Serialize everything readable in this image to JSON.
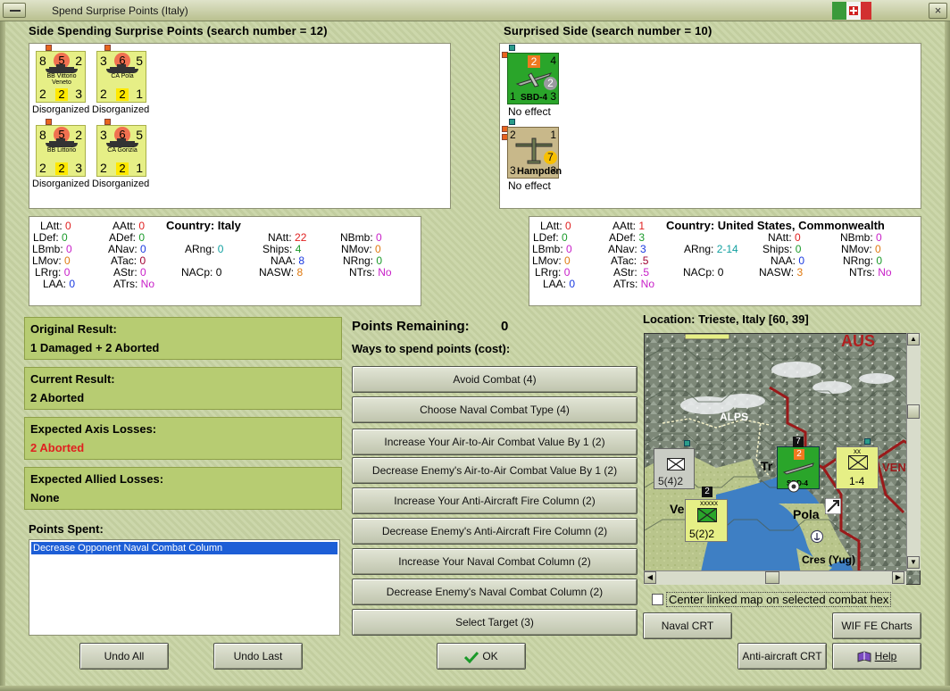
{
  "window": {
    "title": "Spend Surprise Points (Italy)",
    "close": "×"
  },
  "left_side": {
    "title": "Side Spending Surprise Points (search number = 12)",
    "units": [
      {
        "tl": "8",
        "circle": "5",
        "tr": "2",
        "name": "BB Vittorio Veneto",
        "bl": "2",
        "mid": "2",
        "br": "3",
        "status": "Disorganized"
      },
      {
        "tl": "3",
        "circle": "6",
        "tr": "5",
        "name": "CA Pola",
        "bl": "2",
        "mid": "2",
        "br": "1",
        "status": "Disorganized"
      },
      {
        "tl": "8",
        "circle": "5",
        "tr": "2",
        "name": "BB Littorio",
        "bl": "2",
        "mid": "2",
        "br": "3",
        "status": "Disorganized"
      },
      {
        "tl": "3",
        "circle": "6",
        "tr": "5",
        "name": "CA Gorizia",
        "bl": "2",
        "mid": "2",
        "br": "1",
        "status": "Disorganized"
      }
    ]
  },
  "right_side": {
    "title": "Surprised Side (search number = 10)",
    "units": [
      {
        "name": "SBD-4",
        "tl": "2",
        "tr": "4",
        "badge": "2",
        "bl": "1",
        "br": "3",
        "status": "No effect"
      },
      {
        "name": "Hampden",
        "tl": "2",
        "tr": "1",
        "badge": "7",
        "bl": "3",
        "br": "3",
        "status": "No effect"
      }
    ]
  },
  "left_stats": {
    "country_label": "Country:",
    "country": "Italy",
    "LAtt": "0",
    "LDef": "0",
    "LBmb": "0",
    "LMov": "0",
    "LRrg": "0",
    "LAA": "0",
    "AAtt": "0",
    "ADef": "0",
    "ANav": "0",
    "ATac": "0",
    "AStr": "0",
    "ATrs": "No",
    "ARng": "0",
    "NACp": "0",
    "NAtt": "22",
    "Ships": "4",
    "NAA": "8",
    "NASW": "8",
    "NBmb": "0",
    "NMov": "0",
    "NRng": "0",
    "NTrs": "No"
  },
  "right_stats": {
    "country_label": "Country:",
    "country": "United States, Commonwealth",
    "LAtt": "0",
    "LDef": "0",
    "LBmb": "0",
    "LMov": "0",
    "LRrg": "0",
    "LAA": "0",
    "AAtt": "1",
    "ADef": "3",
    "ANav": "3",
    "ATac": ".5",
    "AStr": ".5",
    "ATrs": "No",
    "ARng": "2-14",
    "NACp": "0",
    "NAtt": "0",
    "Ships": "0",
    "NAA": "0",
    "NASW": "3",
    "NBmb": "0",
    "NMov": "0",
    "NRng": "0",
    "NTrs": "No"
  },
  "results": {
    "original_label": "Original Result:",
    "original": "1 Damaged + 2 Aborted",
    "current_label": "Current Result:",
    "current": "2 Aborted",
    "axis_label": "Expected Axis Losses:",
    "axis": "2 Aborted",
    "allied_label": "Expected Allied Losses:",
    "allied": "None",
    "spent_label": "Points Spent:",
    "spent_items": [
      "Decrease Opponent Naval Combat Column"
    ]
  },
  "points": {
    "remaining_label": "Points Remaining:",
    "remaining": "0",
    "ways_label": "Ways to spend points (cost):",
    "options": [
      "Avoid Combat (4)",
      "Choose Naval Combat Type (4)",
      "Increase Your Air-to-Air Combat Value By 1 (2)",
      "Decrease Enemy's Air-to-Air Combat Value By 1 (2)",
      "Increase Your Anti-Aircraft Fire Column (2)",
      "Decrease Enemy's Anti-Aircraft Fire Column (2)",
      "Increase Your Naval Combat Column (2)",
      "Decrease Enemy's Naval Combat Column (2)",
      "Select Target (3)"
    ]
  },
  "map": {
    "location": "Location: Trieste, Italy [60, 39]",
    "labels": {
      "alps": "ALPS",
      "aus": "AUS",
      "pola": "Pola",
      "cres": "Cres (Yug)",
      "ve": "Ve",
      "tr": "Tr",
      "ven": "VEN"
    },
    "counters": {
      "a": "5(4)2",
      "b": "5(2)2",
      "b_top": "xxxxx",
      "c": "1-4",
      "c_top": "xx",
      "d_name": "SBD-4",
      "d_num": "7",
      "d_top": "2",
      "b_num": "2"
    },
    "center_checkbox": "Center linked map on selected combat hex",
    "center_checked": false
  },
  "buttons": {
    "undo_all": "Undo All",
    "undo_last": "Undo Last",
    "ok": "OK",
    "naval_crt": "Naval CRT",
    "wif_charts": "WIF FE Charts",
    "aa_crt": "Anti-aircraft CRT",
    "help": "Help"
  },
  "colors": {
    "panel_green": "#b7cc72",
    "loss_red": "#e02020",
    "select_blue": "#1d5ed6",
    "counter_yellow": "#e6ef86",
    "us_green": "#2aa52a"
  }
}
